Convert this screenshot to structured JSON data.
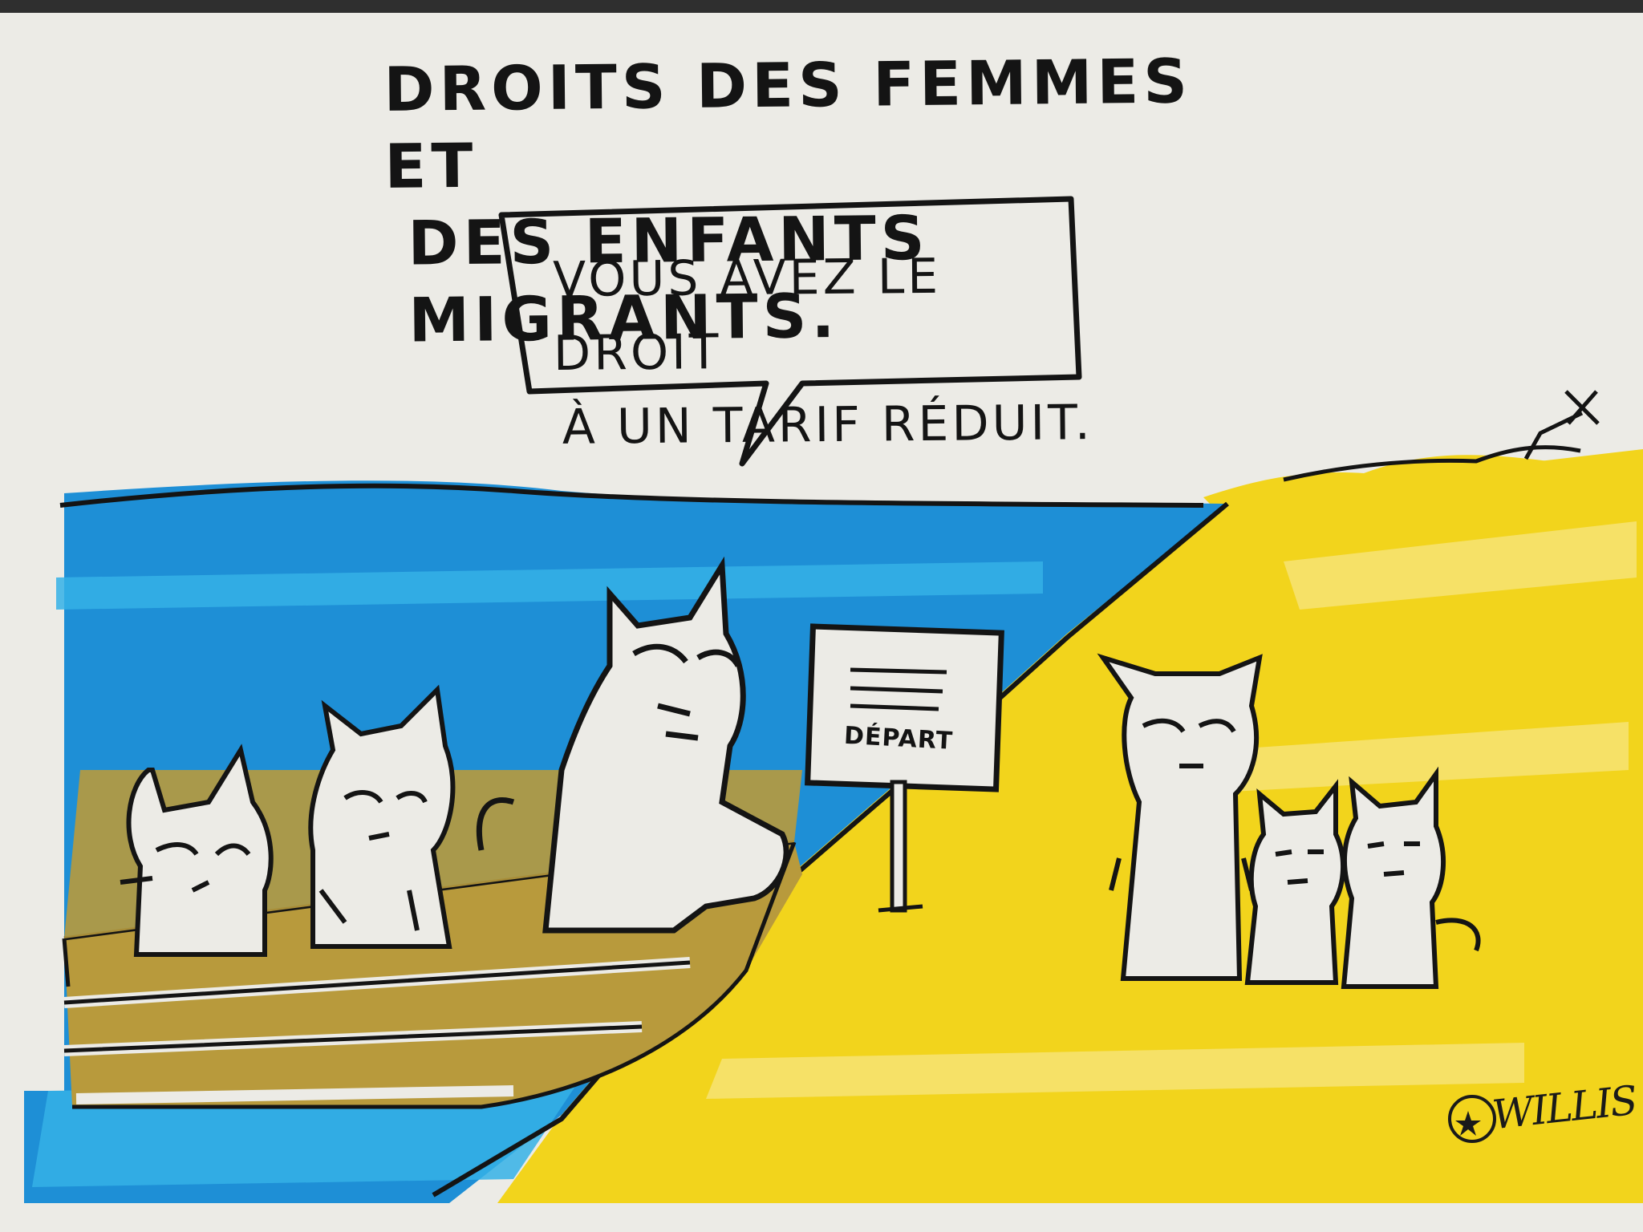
{
  "title": {
    "line1": "DROITS DES FEMMES ET",
    "line2": "DES ENFANTS MIGRANTS."
  },
  "speech_bubble": {
    "line1": "VOUS AVEZ LE DROIT",
    "line2": "À UN TARIF RÉDUIT."
  },
  "sign": {
    "label": "DÉPART"
  },
  "signature": {
    "name": "WILLIS"
  },
  "colors": {
    "paper": "#ecebe6",
    "sea": "#1e8fd6",
    "sea_light": "#35b2e6",
    "sand": "#f2d41c",
    "sand_light": "#f6e37a",
    "boat": "#b89a3c",
    "ink": "#141414"
  }
}
